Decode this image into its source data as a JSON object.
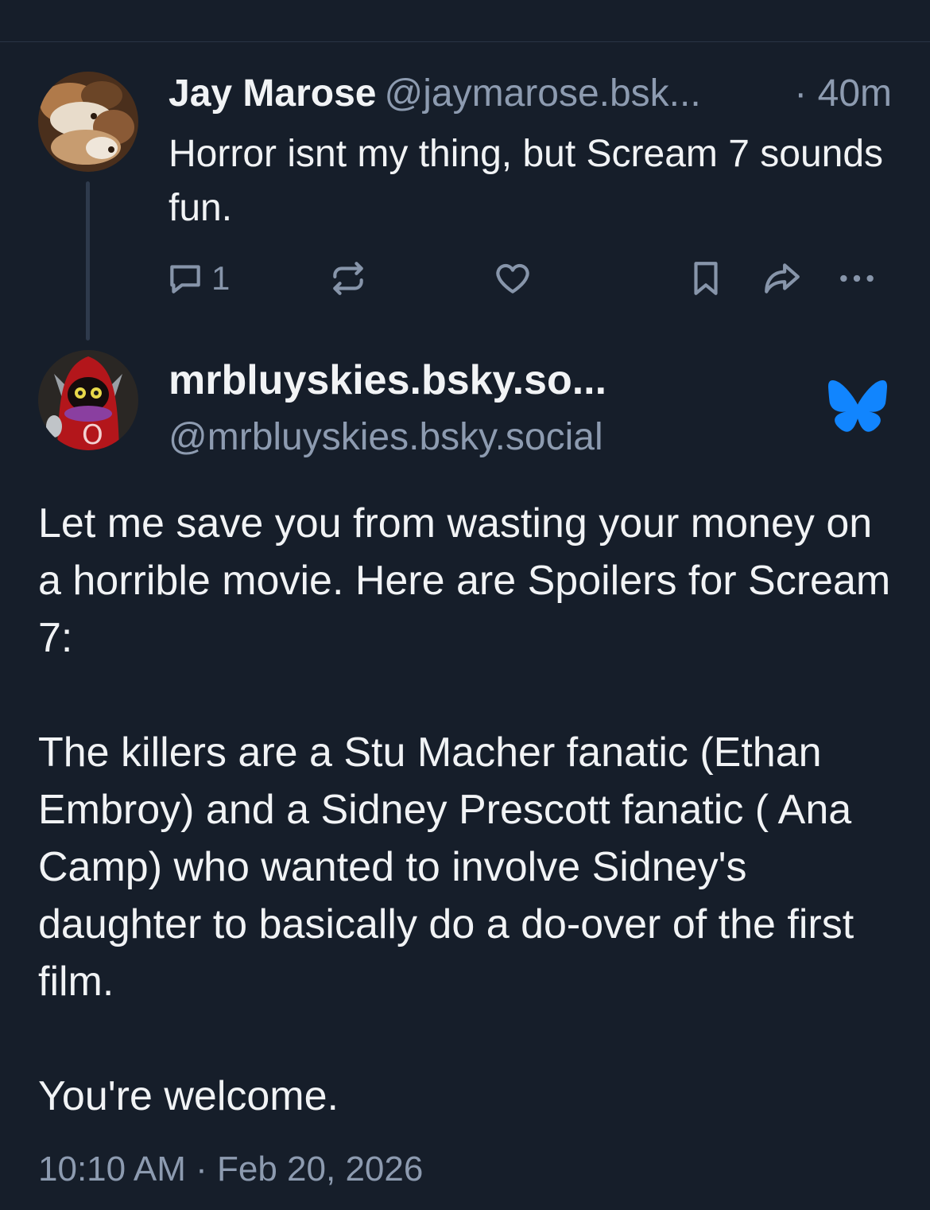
{
  "parent_post": {
    "display_name": "Jay Marose",
    "handle": "@jaymarose.bsk...",
    "time": "· 40m",
    "text": "Horror isnt my thing, but Scream 7 sounds fun.",
    "reply_count": "1"
  },
  "main_post": {
    "display_name": "mrbluyskies.bsky.so...",
    "handle": "@mrbluyskies.bsky.social",
    "paragraphs": [
      "Let me save you from wasting your money on a horrible movie. Here are Spoilers for Scream 7:",
      "The killers are a Stu Macher fanatic (Ethan Embroy) and a Sidney Prescott fanatic ( Ana Camp) who wanted to involve Sidney's daughter to basically do a do-over of the first film.",
      "You're welcome."
    ],
    "timestamp": "10:10 AM · Feb 20, 2026"
  },
  "icons": {
    "reply": "reply-icon",
    "repost": "repost-icon",
    "like": "heart-icon",
    "bookmark": "bookmark-icon",
    "share": "share-icon",
    "more": "more-icon",
    "verified": "bluesky-butterfly-icon"
  },
  "colors": {
    "background": "#161e2a",
    "text": "#f1f3f5",
    "muted": "#8d9bb0",
    "brand_blue": "#1185fe"
  }
}
